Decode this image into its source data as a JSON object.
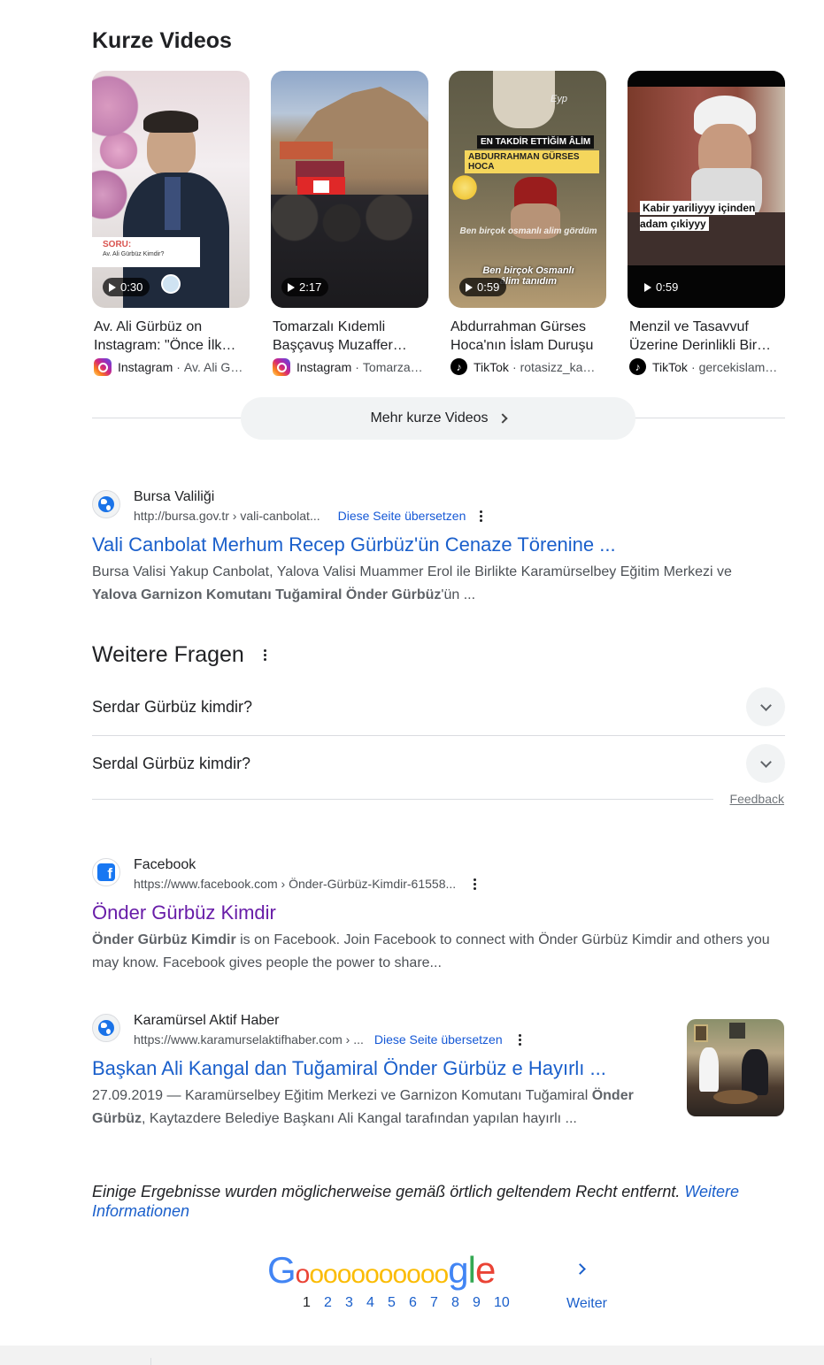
{
  "short_videos": {
    "heading": "Kurze Videos",
    "more_button": "Mehr kurze Videos",
    "items": [
      {
        "duration": "0:30",
        "title": "Av. Ali Gürbüz on Instagram: \"Önce İlk…",
        "source": "Instagram",
        "author": "Av. Ali G…",
        "platform_icon": "instagram-icon",
        "overlay_label": "SORU:",
        "overlay_sub": "Av. Ali Gürbüz Kimdir?"
      },
      {
        "duration": "2:17",
        "title": "Tomarzalı Kıdemli Başçavuş Muzaffer…",
        "source": "Instagram",
        "author": "Tomarza…",
        "platform_icon": "instagram-icon"
      },
      {
        "duration": "0:59",
        "title": "Abdurrahman Gürses Hoca'nın İslam Duruşu",
        "source": "TikTok",
        "author": "rotasizz_ka…",
        "platform_icon": "tiktok-icon",
        "overlay_label": "EN TAKDİR ETTİĞİM ÂLİM",
        "overlay_sub": "ABDURRAHMAN GÜRSES HOCA",
        "overlay_text2": "Ben birçok osmanlı alim gördüm",
        "overlay_text3": "Ben birçok Osmanlı âlim tanıdım",
        "overlay_corner": "Eyp"
      },
      {
        "duration": "0:59",
        "title": "Menzil ve Tasavvuf Üzerine Derinlikli Bir…",
        "source": "TikTok",
        "author": "gercekislam…",
        "platform_icon": "tiktok-icon",
        "overlay_label": "Kabir yariliyyy içinden adam çıkiyyy"
      }
    ]
  },
  "result1": {
    "site_name": "Bursa Valiliği",
    "url": "http://bursa.gov.tr › vali-canbolat...",
    "translate": "Diese Seite übersetzen",
    "title": "Vali Canbolat Merhum Recep Gürbüz'ün Cenaze Törenine ...",
    "snippet_1": "Bursa Valisi Yakup Canbolat, Yalova Valisi Muammer Erol ile Birlikte Karamürselbey Eğitim Merkezi ve",
    "snippet_bold": "Yalova Garnizon Komutanı Tuğamiral Önder Gürbüz",
    "snippet_2": "'ün ..."
  },
  "faq": {
    "heading": "Weitere Fragen",
    "questions": [
      "Serdar Gürbüz kimdir?",
      "Serdal Gürbüz kimdir?"
    ],
    "feedback": "Feedback"
  },
  "result2": {
    "site_name": "Facebook",
    "url": "https://www.facebook.com › Önder-Gürbüz-Kimdir-61558...",
    "title": "Önder Gürbüz Kimdir",
    "snippet_bold": "Önder Gürbüz Kimdir",
    "snippet_1": " is on Facebook. Join Facebook to connect with Önder Gürbüz Kimdir and others you may know. Facebook gives people the power to share..."
  },
  "result3": {
    "site_name": "Karamürsel Aktif Haber",
    "url": "https://www.karamurselaktifhaber.com › ...",
    "translate": "Diese Seite übersetzen",
    "title": "Başkan Ali Kangal dan Tuğamiral Önder Gürbüz e Hayırlı ...",
    "snippet_1": "27.09.2019 — Karamürselbey Eğitim Merkezi ve Garnizon Komutanı Tuğamiral ",
    "snippet_bold_1": "Önder",
    "snippet_bold_2": "Gürbüz",
    "snippet_2": ", Kaytazdere Belediye Başkanı Ali Kangal tarafından yapılan hayırlı ..."
  },
  "notice": {
    "text": "Einige Ergebnisse wurden möglicherweise gemäß örtlich geltendem Recht entfernt. ",
    "link": "Weitere Informationen"
  },
  "pagination": {
    "current": "1",
    "pages": [
      "2",
      "3",
      "4",
      "5",
      "6",
      "7",
      "8",
      "9",
      "10"
    ],
    "next": "Weiter",
    "logo_letters": [
      "G",
      "o",
      "o",
      "o",
      "o",
      "o",
      "o",
      "o",
      "o",
      "o",
      "o",
      "o",
      "g",
      "l",
      "e"
    ]
  },
  "colors": {
    "link_blue": "#1a5fcb",
    "visited_purple": "#681da8",
    "google_blue": "#4285f4",
    "google_red": "#ea4335",
    "google_yellow": "#fbbc05",
    "google_green": "#34a853"
  }
}
